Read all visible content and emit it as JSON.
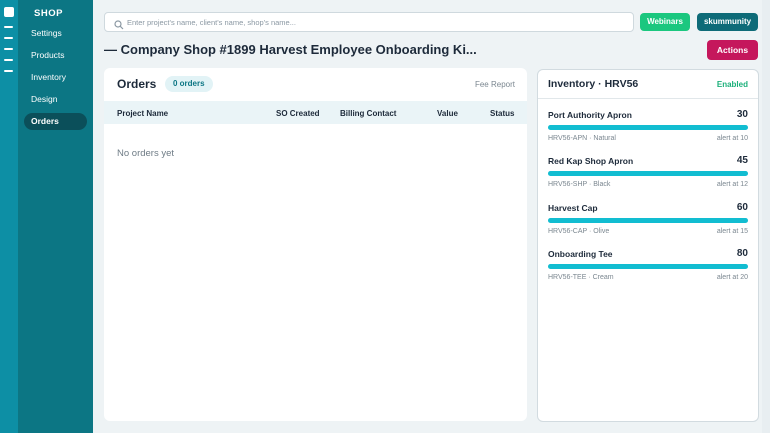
{
  "sidebar": {
    "title": "SHOP",
    "items": [
      {
        "label": "Settings"
      },
      {
        "label": "Products"
      },
      {
        "label": "Inventory"
      },
      {
        "label": "Design"
      },
      {
        "label": "Orders"
      }
    ],
    "active": "Orders"
  },
  "search": {
    "placeholder": "Enter project's name, client's name, shop's name..."
  },
  "header": {
    "webinars_label": "Webinars",
    "user_label": "skummunity",
    "page_title": "— Company Shop #1899 Harvest Employee Onboarding Ki...",
    "actions_label": "Actions"
  },
  "orders": {
    "title": "Orders",
    "count_badge": "0 orders",
    "fee_report_label": "Fee Report",
    "columns": [
      "Project Name",
      "SO Created",
      "Billing Contact",
      "Value",
      "Status"
    ],
    "empty_message": "No orders yet"
  },
  "inventory": {
    "title": "Inventory · HRV56",
    "status": "Enabled",
    "items": [
      {
        "name": "Port Authority Apron",
        "qty": "30",
        "sku": "HRV56-APN · Natural",
        "alert": "alert at 10",
        "level": 1.0
      },
      {
        "name": "Red Kap Shop Apron",
        "qty": "45",
        "sku": "HRV56-SHP · Black",
        "alert": "alert at 12",
        "level": 1.0
      },
      {
        "name": "Harvest Cap",
        "qty": "60",
        "sku": "HRV56-CAP · Olive",
        "alert": "alert at 15",
        "level": 1.0
      },
      {
        "name": "Onboarding Tee",
        "qty": "80",
        "sku": "HRV56-TEE · Cream",
        "alert": "alert at 20",
        "level": 1.0
      }
    ]
  },
  "colors": {
    "rail": "#0d8fa5",
    "sidebar": "#0c7684",
    "webinars": "#1bc77f",
    "user": "#0e6b78",
    "actions": "#c5175c",
    "bar_fill": "#12bdd1",
    "enabled": "#1bb07a"
  }
}
